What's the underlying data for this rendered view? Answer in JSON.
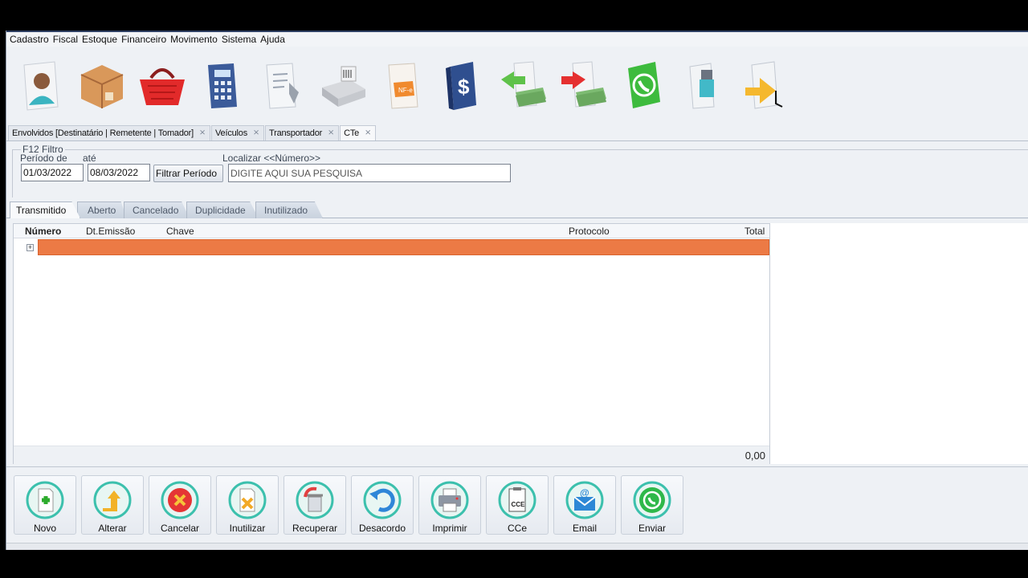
{
  "menu": [
    "Cadastro",
    "Fiscal",
    "Estoque",
    "Financeiro",
    "Movimento",
    "Sistema",
    "Ajuda"
  ],
  "toolbar_icons": [
    "person-icon",
    "box-icon",
    "basket-icon",
    "calculator-icon",
    "document-tools-icon",
    "cash-register-icon",
    "nfe-document-icon",
    "cashbook-icon",
    "money-in-icon",
    "money-out-icon",
    "whatsapp-app-icon",
    "usb-drive-icon",
    "exit-arrow-icon"
  ],
  "doc_tabs": [
    {
      "label": "Envolvidos [Destinatário | Remetente | Tomador]",
      "active": false
    },
    {
      "label": "Veículos",
      "active": false
    },
    {
      "label": "Transportador",
      "active": false
    },
    {
      "label": "CTe",
      "active": true
    }
  ],
  "filter": {
    "legend": "F12 Filtro",
    "period_label": "Período de",
    "until_label": "até",
    "date_from": "01/03/2022",
    "date_to": "08/03/2022",
    "filter_button": "Filtrar Período",
    "search_label": "Localizar <<Número>>",
    "search_value": "DIGITE AQUI SUA PESQUISA"
  },
  "status_tabs": [
    {
      "label": "Transmitido",
      "active": true
    },
    {
      "label": "Aberto",
      "active": false
    },
    {
      "label": "Cancelado",
      "active": false
    },
    {
      "label": "Duplicidade",
      "active": false
    },
    {
      "label": "Inutilizado",
      "active": false
    }
  ],
  "grid": {
    "columns": [
      "Número",
      "Dt.Emissão",
      "Chave",
      "Protocolo",
      "Total"
    ],
    "total": "0,00",
    "row_highlight_color": "#ec7a45"
  },
  "actions": [
    {
      "label": "Novo",
      "icon": "add-document-icon"
    },
    {
      "label": "Alterar",
      "icon": "edit-arrow-icon"
    },
    {
      "label": "Cancelar",
      "icon": "cancel-icon"
    },
    {
      "label": "Inutilizar",
      "icon": "void-document-icon"
    },
    {
      "label": "Recuperar",
      "icon": "recover-trash-icon"
    },
    {
      "label": "Desacordo",
      "icon": "undo-icon"
    },
    {
      "label": "Imprimir",
      "icon": "printer-icon"
    },
    {
      "label": "CCe",
      "icon": "cce-document-icon"
    },
    {
      "label": "Email",
      "icon": "email-icon"
    },
    {
      "label": "Enviar",
      "icon": "whatsapp-icon"
    }
  ]
}
